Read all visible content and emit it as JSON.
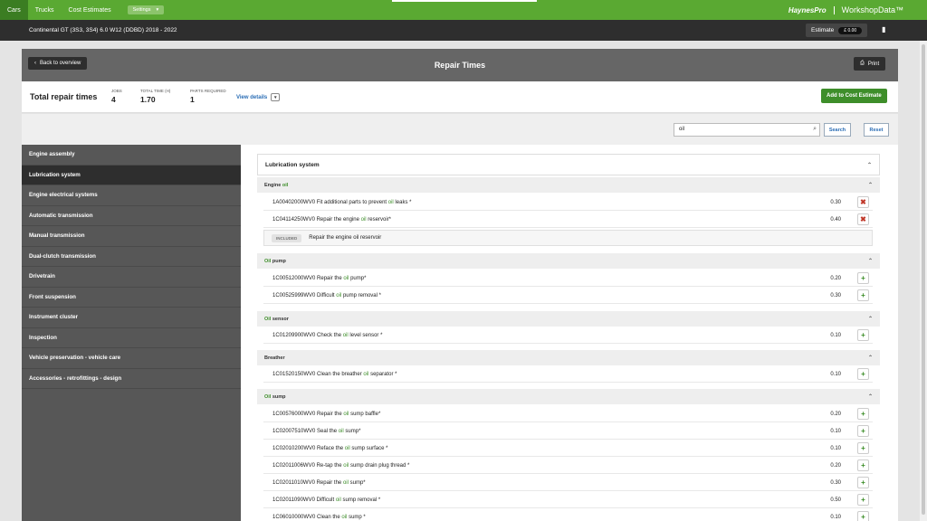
{
  "nav": {
    "tabs": [
      {
        "label": "Cars"
      },
      {
        "label": "Trucks"
      },
      {
        "label": "Cost Estimates"
      }
    ],
    "settings_label": "Settings",
    "brand_hp": "HaynesPro",
    "brand_wd": "WorkshopData™"
  },
  "vehicle": {
    "title": "Continental GT (3S3, 3S4) 6.0 W12 (DDBD) 2018 - 2022",
    "estimate_label": "Estimate",
    "estimate_value": "£  0.00"
  },
  "panel": {
    "back_label": "Back to overview",
    "title": "Repair Times",
    "print_label": "Print"
  },
  "summary": {
    "label": "Total repair times",
    "jobs_cap": "JOBS",
    "jobs": "4",
    "time_cap": "TOTAL TIME (H)",
    "time": "1.70",
    "parts_cap": "PARTS REQUIRED",
    "parts": "1",
    "view_details": "View details",
    "add_label": "Add to Cost Estimate"
  },
  "search": {
    "value": "oil",
    "search_label": "Search",
    "reset_label": "Reset"
  },
  "sidebar": {
    "items": [
      {
        "label": "Engine assembly"
      },
      {
        "label": "Lubrication system"
      },
      {
        "label": "Engine electrical systems"
      },
      {
        "label": "Automatic transmission"
      },
      {
        "label": "Manual transmission"
      },
      {
        "label": "Dual-clutch transmission"
      },
      {
        "label": "Drivetrain"
      },
      {
        "label": "Front suspension"
      },
      {
        "label": "Instrument cluster"
      },
      {
        "label": "Inspection"
      },
      {
        "label": "Vehicle preservation - vehicle care"
      },
      {
        "label": "Accessories - retrofittings - design"
      }
    ]
  },
  "card_title": "Lubrication system",
  "sections": [
    {
      "pre": "Engine ",
      "hl": "oil",
      "post": ""
    },
    {
      "pre": "",
      "hl": "Oil",
      "post": " pump"
    },
    {
      "pre": "",
      "hl": "Oil",
      "post": " sensor"
    },
    {
      "pre": "Breather",
      "hl": "",
      "post": ""
    },
    {
      "pre": "",
      "hl": "Oil",
      "post": " sump"
    }
  ],
  "included": {
    "tag": "INCLUDED",
    "text": "Repair the engine oil reservoir"
  },
  "rows": [
    {
      "pre": "1A00402000WV0 Fit additional parts to prevent ",
      "hl": "oil",
      "post": " leaks *",
      "time": "0.30",
      "action": "✖"
    },
    {
      "pre": "1C04114250WV0 Repair the engine ",
      "hl": "oil",
      "post": " reservoir*",
      "time": "0.40",
      "action": "✖"
    },
    {
      "pre": "1C00512000WV0 Repair the ",
      "hl": "oil",
      "post": " pump*",
      "time": "0.20",
      "action": "+"
    },
    {
      "pre": "1C00525999WV0 Difficult ",
      "hl": "oil",
      "post": " pump removal *",
      "time": "0.30",
      "action": "+"
    },
    {
      "pre": "1C01209900WV0 Check the ",
      "hl": "oil",
      "post": " level sensor *",
      "time": "0.10",
      "action": "+"
    },
    {
      "pre": "1C01520150WV0 Clean the breather ",
      "hl": "oil",
      "post": " separator *",
      "time": "0.10",
      "action": "+"
    },
    {
      "pre": "1C00576000WV0 Repair the ",
      "hl": "oil",
      "post": " sump baffle*",
      "time": "0.20",
      "action": "+"
    },
    {
      "pre": "1C02007510WV0 Seal the ",
      "hl": "oil",
      "post": " sump*",
      "time": "0.10",
      "action": "+"
    },
    {
      "pre": "1C02010200WV0 Reface the ",
      "hl": "oil",
      "post": " sump surface *",
      "time": "0.10",
      "action": "+"
    },
    {
      "pre": "1C02011006WV0 Re-tap the ",
      "hl": "oil",
      "post": " sump drain plug thread *",
      "time": "0.20",
      "action": "+"
    },
    {
      "pre": "1C02011010WV0 Repair the ",
      "hl": "oil",
      "post": " sump*",
      "time": "0.30",
      "action": "+"
    },
    {
      "pre": "1C02011090WV0 Difficult ",
      "hl": "oil",
      "post": " sump removal *",
      "time": "0.50",
      "action": "+"
    },
    {
      "pre": "1C06010000WV0 Clean the ",
      "hl": "oil",
      "post": " sump *",
      "time": "0.10",
      "action": "+"
    }
  ],
  "colors": {
    "green": "#5aa932",
    "dark": "#2e2e2e",
    "accent": "#3e8e2a",
    "link": "#2a6db5"
  }
}
